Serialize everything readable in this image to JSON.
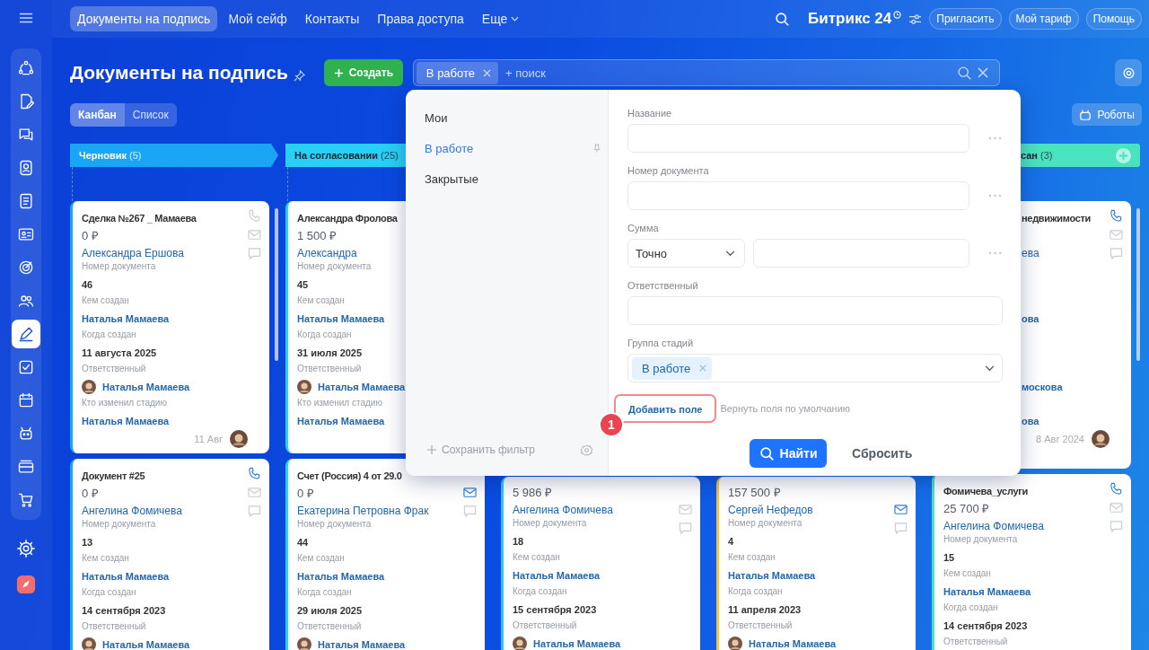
{
  "topbar": {
    "tabs": [
      {
        "label": "Документы на подпись",
        "selected": true,
        "kind": "link"
      },
      {
        "label": "Мой сейф",
        "selected": false,
        "kind": "link"
      },
      {
        "label": "Контакты",
        "selected": false,
        "kind": "link"
      },
      {
        "label": "Права доступа",
        "selected": false,
        "kind": "link"
      },
      {
        "label": "Еще",
        "selected": false,
        "kind": "menu"
      }
    ],
    "logo": "Битрикс 24",
    "buttons": [
      "Пригласить",
      "Мой тариф",
      "Помощь"
    ]
  },
  "sidebar": {
    "items": [
      {
        "kind": "cycle",
        "selected": false
      },
      {
        "kind": "doc-edit",
        "selected": false
      },
      {
        "kind": "chat",
        "selected": false
      },
      {
        "kind": "contact",
        "selected": false
      },
      {
        "kind": "doc-list",
        "selected": false
      },
      {
        "kind": "id-card",
        "selected": false
      },
      {
        "kind": "target",
        "selected": false
      },
      {
        "kind": "people",
        "selected": false
      },
      {
        "kind": "pen",
        "selected": true
      },
      {
        "kind": "check",
        "selected": false
      },
      {
        "kind": "calendar",
        "selected": false
      },
      {
        "kind": "robot",
        "selected": false
      },
      {
        "kind": "stack",
        "selected": false
      },
      {
        "kind": "cart",
        "selected": false
      }
    ],
    "bottom_items": [
      {
        "kind": "gear",
        "selected": false
      },
      {
        "kind": "app",
        "selected": false
      }
    ]
  },
  "page": {
    "title": "Документы на подпись",
    "create_button": "Создать",
    "search": {
      "tag": "В работе",
      "placeholder": "+ поиск"
    },
    "views": [
      {
        "label": "Канбан",
        "selected": true
      },
      {
        "label": "Список",
        "selected": false
      }
    ],
    "robots_button": "Роботы"
  },
  "columns": [
    {
      "color": "#1aa6f5",
      "header": {
        "kind": "arrow",
        "title": "Черновик",
        "count": "(5)"
      },
      "first_card": {
        "title": "Сделка №267 _ Мамаева",
        "amount": "0 ₽",
        "contact": "Александра Ершова",
        "icons": [
          {
            "kind": "phone",
            "active": false
          },
          {
            "kind": "mail",
            "active": false
          },
          {
            "kind": "chat",
            "active": false
          }
        ],
        "fields": [
          {
            "label": "Номер документа",
            "value": "46",
            "kind": "text"
          },
          {
            "label": "Кем создан",
            "value": "Наталья Мамаева",
            "kind": "link"
          },
          {
            "label": "Когда создан",
            "value": "11 августа 2025",
            "kind": "text"
          },
          {
            "label": "Ответственный",
            "value": "Наталья Мамаева",
            "kind": "person"
          },
          {
            "label": "Кто изменил стадию",
            "value": "Наталья Мамаева",
            "kind": "link"
          }
        ],
        "footer": "11 Авг"
      },
      "second_card": {
        "title": "Документ #25",
        "amount": "0 ₽",
        "contact": "Ангелина Фомичева",
        "icons": [
          {
            "kind": "phone",
            "active": true
          },
          {
            "kind": "mail",
            "active": false
          },
          {
            "kind": "chat",
            "active": false
          }
        ],
        "fields": [
          {
            "label": "Номер документа",
            "value": "13",
            "kind": "text"
          },
          {
            "label": "Кем создан",
            "value": "Наталья Мамаева",
            "kind": "link"
          },
          {
            "label": "Когда создан",
            "value": "14 сентября 2023",
            "kind": "text"
          },
          {
            "label": "Ответственный",
            "value": "Наталья Мамаева",
            "kind": "person"
          }
        ]
      }
    },
    {
      "color": "#29d0f5",
      "header": {
        "kind": "arrow",
        "title": "На согласовании",
        "count": "(25)"
      },
      "first_card": {
        "title": "Александра Фролова",
        "amount": "1 500 ₽",
        "contact": "Александра",
        "fields": [
          {
            "label": "Номер документа",
            "value": "45",
            "kind": "text"
          },
          {
            "label": "Кем создан",
            "value": "Наталья Мамаева",
            "kind": "link"
          },
          {
            "label": "Когда создан",
            "value": "31 июля 2025",
            "kind": "text"
          },
          {
            "label": "Ответственный",
            "value": "Наталья Мамаева",
            "kind": "person"
          },
          {
            "label": "Кто изменил стадию",
            "value": "Наталья Мамаева",
            "kind": "link"
          }
        ]
      },
      "second_card": {
        "title": "Счет (Россия) 4 от 29.0",
        "amount": "0 ₽",
        "contact": "Екатерина Петровна Фрак",
        "icons": [
          {
            "kind": "mail",
            "active": true
          },
          {
            "kind": "chat",
            "active": false
          }
        ],
        "fields": [
          {
            "label": "Номер документа",
            "value": "44",
            "kind": "text"
          },
          {
            "label": "Кем создан",
            "value": "Наталья Мамаева",
            "kind": "link"
          },
          {
            "label": "Когда создан",
            "value": "29 июля 2025",
            "kind": "text"
          },
          {
            "label": "Ответственный",
            "value": "Наталья Мамаева",
            "kind": "person"
          }
        ]
      }
    },
    {
      "color": "#2fc6f6",
      "second_card": {
        "amount": "5 986 ₽",
        "contact": "Ангелина Фомичева",
        "icons": [
          {
            "kind": "mail",
            "active": false
          },
          {
            "kind": "chat",
            "active": false
          }
        ],
        "fields": [
          {
            "label": "Номер документа",
            "value": "18",
            "kind": "text"
          },
          {
            "label": "Кем создан",
            "value": "Наталья Мамаева",
            "kind": "link"
          },
          {
            "label": "Когда создан",
            "value": "15 сентября 2023",
            "kind": "text"
          },
          {
            "label": "Ответственный",
            "value": "Наталья Мамаева",
            "kind": "person"
          }
        ]
      }
    },
    {
      "color": "#f7c141",
      "second_card": {
        "amount": "157 500 ₽",
        "contact": "Сергей Нефедов",
        "icons": [
          {
            "kind": "mail",
            "active": true
          },
          {
            "kind": "chat",
            "active": false
          }
        ],
        "fields": [
          {
            "label": "Номер документа",
            "value": "4",
            "kind": "text"
          },
          {
            "label": "Кем создан",
            "value": "Наталья Мамаева",
            "kind": "link"
          },
          {
            "label": "Когда создан",
            "value": "11 апреля 2023",
            "kind": "text"
          },
          {
            "label": "Ответственный",
            "value": "Наталья Мамаева",
            "kind": "person"
          }
        ]
      }
    },
    {
      "color": "#4ae3c0",
      "header": {
        "kind": "last",
        "title": "сан",
        "count": "(3)",
        "cut": true
      },
      "first_card": {
        "cut": true,
        "title": "недвижимости",
        "contact": "ева",
        "icons": [
          {
            "kind": "phone",
            "active": true
          },
          {
            "kind": "mail",
            "active": false
          },
          {
            "kind": "chat",
            "active": false
          }
        ],
        "fields": [
          {
            "kind": "text"
          },
          {
            "value": "ова",
            "kind": "link"
          },
          {
            "kind": "text"
          },
          {
            "value": "москова",
            "kind": "person"
          },
          {
            "value": "ова",
            "kind": "link"
          }
        ],
        "footer": "8 Авг 2024"
      },
      "second_card": {
        "title": "Фомичева_услуги",
        "amount": "25 700 ₽",
        "contact": "Ангелина Фомичева",
        "icons": [
          {
            "kind": "phone",
            "active": true
          },
          {
            "kind": "mail",
            "active": false
          },
          {
            "kind": "chat",
            "active": false
          }
        ],
        "fields": [
          {
            "label": "Номер документа",
            "value": "15",
            "kind": "text"
          },
          {
            "label": "Кем создан",
            "value": "Наталья Мамаева",
            "kind": "link"
          },
          {
            "label": "Когда создан",
            "value": "14 сентября 2023",
            "kind": "text"
          },
          {
            "label": "Ответственный",
            "kind": "text"
          }
        ]
      }
    }
  ],
  "filter_popup": {
    "presets": [
      {
        "label": "Мои",
        "selected": false
      },
      {
        "label": "В работе",
        "selected": true
      },
      {
        "label": "Закрытые",
        "selected": false
      }
    ],
    "save_filter": "Сохранить фильтр",
    "fields": [
      {
        "kind": "input",
        "label": "Название"
      },
      {
        "kind": "input",
        "label": "Номер документа"
      },
      {
        "kind": "range",
        "label": "Сумма",
        "select": "Точно"
      },
      {
        "kind": "wide",
        "label": "Ответственный"
      },
      {
        "kind": "tags",
        "label": "Группа стадий",
        "tags": [
          "В работе"
        ]
      }
    ],
    "add_field": "Добавить поле",
    "restore": "Вернуть поля по умолчанию",
    "callout": "1",
    "find_button": "Найти",
    "reset_button": "Сбросить"
  }
}
